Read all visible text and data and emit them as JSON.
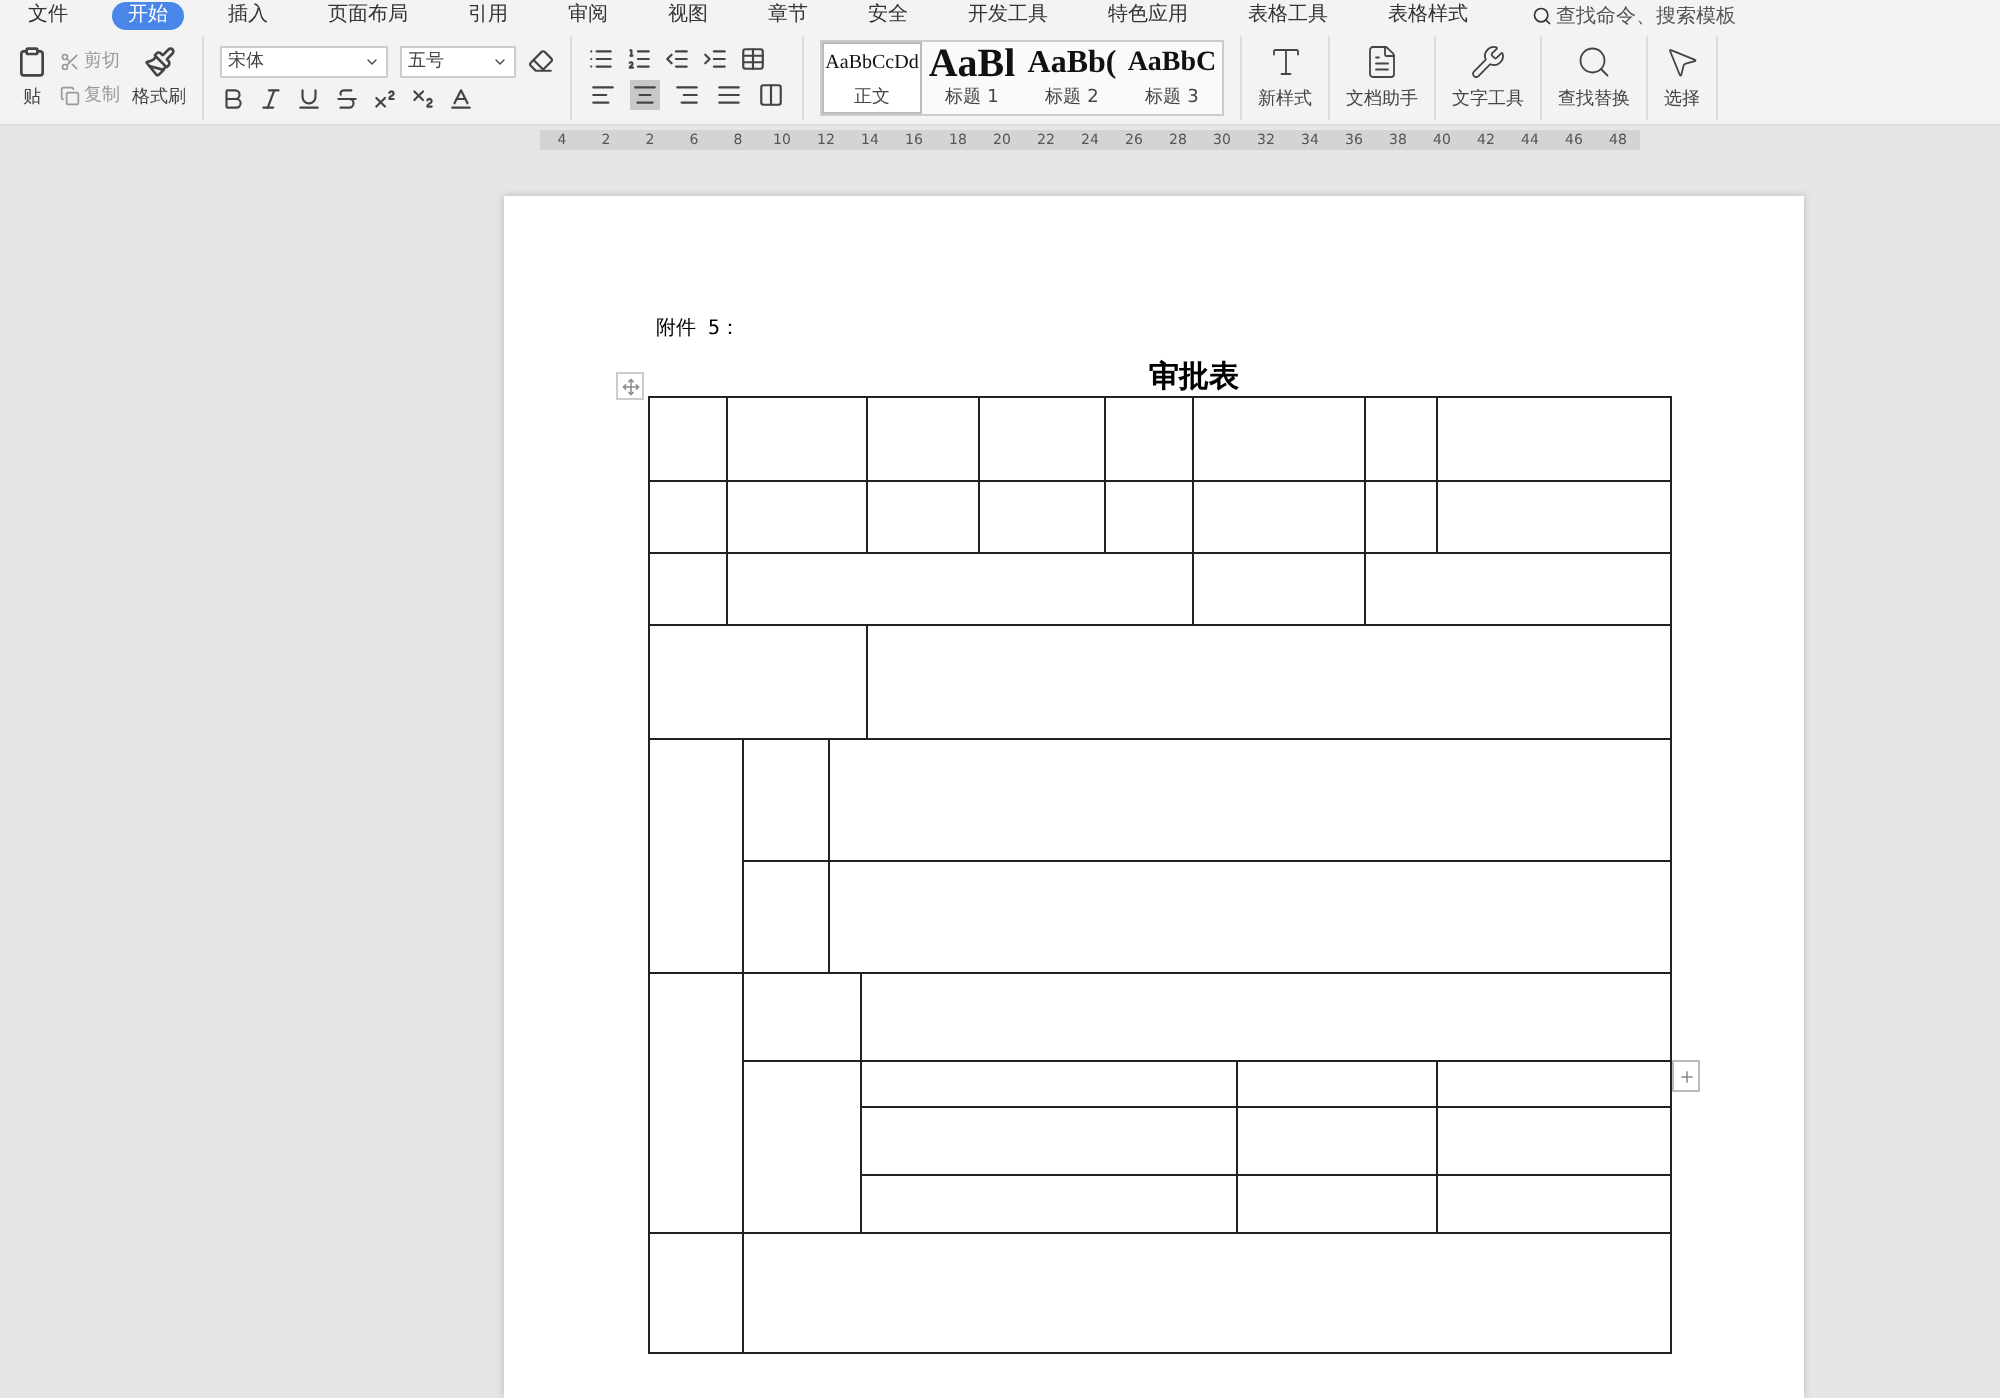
{
  "menu_tabs": [
    {
      "label": "文件",
      "selected": false
    },
    {
      "label": "开始",
      "selected": true
    },
    {
      "label": "插入",
      "selected": false
    },
    {
      "label": "页面布局",
      "selected": false
    },
    {
      "label": "引用",
      "selected": false
    },
    {
      "label": "审阅",
      "selected": false
    },
    {
      "label": "视图",
      "selected": false
    },
    {
      "label": "章节",
      "selected": false
    },
    {
      "label": "安全",
      "selected": false
    },
    {
      "label": "开发工具",
      "selected": false
    },
    {
      "label": "特色应用",
      "selected": false
    },
    {
      "label": "表格工具",
      "selected": false
    },
    {
      "label": "表格样式",
      "selected": false
    }
  ],
  "command_search": {
    "placeholder": "查找命令、搜索模板"
  },
  "clipboard": {
    "paste": "贴",
    "cut": "剪切",
    "copy": "复制",
    "format_painter": "格式刷"
  },
  "font": {
    "name": "宋体",
    "size": "五号"
  },
  "align_buttons": [
    {
      "kind": "left",
      "selected": false
    },
    {
      "kind": "center",
      "selected": true
    },
    {
      "kind": "right",
      "selected": false
    },
    {
      "kind": "justify",
      "selected": false
    },
    {
      "kind": "distributed",
      "selected": false
    }
  ],
  "styles": [
    {
      "preview": "AaBbCcDd",
      "label": "正文",
      "selected": true,
      "kind": "body"
    },
    {
      "preview": "AaBl",
      "label": "标题 1",
      "selected": false,
      "kind": "h1"
    },
    {
      "preview": "AaBb(",
      "label": "标题 2",
      "selected": false,
      "kind": "h2"
    },
    {
      "preview": "AaBbC",
      "label": "标题 3",
      "selected": false,
      "kind": "h3"
    }
  ],
  "tools": [
    {
      "label": "新样式",
      "kind": "styles"
    },
    {
      "label": "文档助手",
      "kind": "doc"
    },
    {
      "label": "文字工具",
      "kind": "wrench"
    },
    {
      "label": "查找替换",
      "kind": "search"
    },
    {
      "label": "选择",
      "kind": "pointer"
    }
  ],
  "ruler": [
    "4",
    "2",
    "2",
    "6",
    "8",
    "10",
    "12",
    "14",
    "16",
    "18",
    "20",
    "22",
    "24",
    "26",
    "28",
    "30",
    "32",
    "34",
    "36",
    "38",
    "40",
    "42",
    "44",
    "46",
    "48"
  ],
  "document": {
    "attachment": "附件 5：",
    "title": "审批表"
  }
}
